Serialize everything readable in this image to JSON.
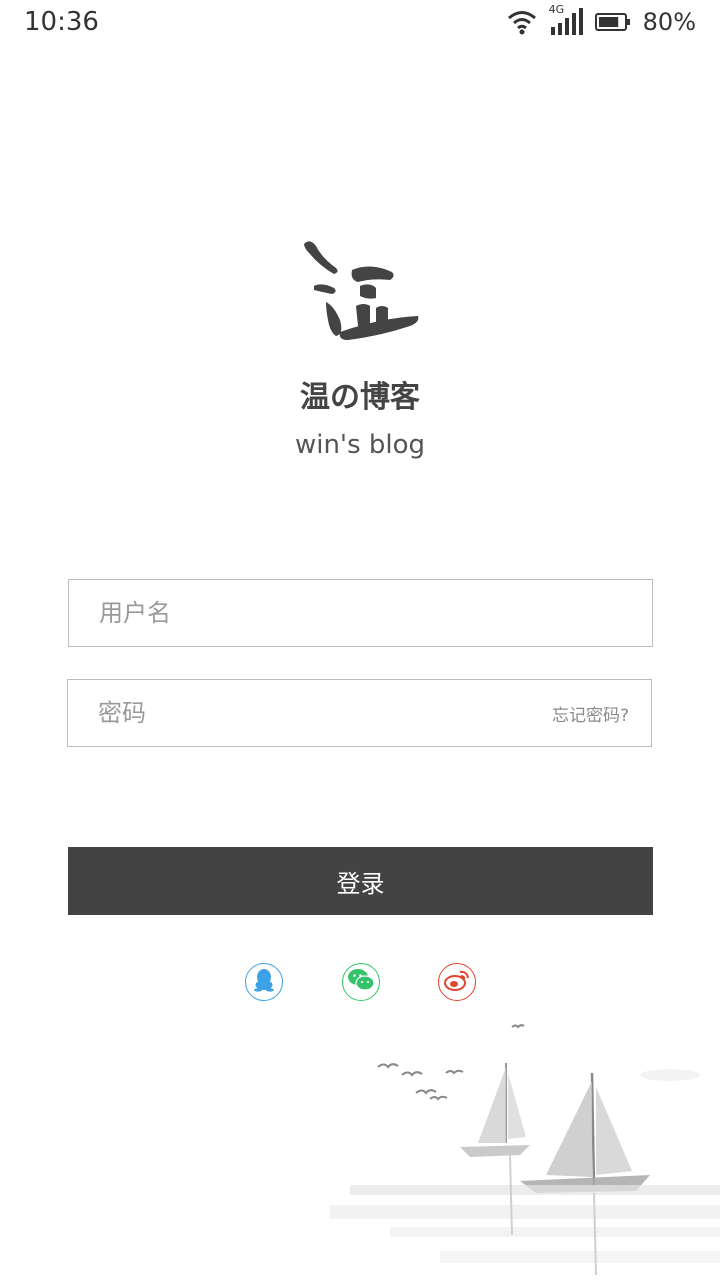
{
  "status_bar": {
    "time": "10:36",
    "network_label": "4G",
    "battery_percent": "80%",
    "battery_level": 0.8,
    "icons": [
      "wifi-icon",
      "cellular-signal-icon",
      "battery-icon"
    ]
  },
  "brand": {
    "logo_icon": "wen-calligraphy-logo",
    "title": "温の博客",
    "subtitle": "win's blog"
  },
  "login_form": {
    "username_placeholder": "用户名",
    "username_value": "",
    "password_placeholder": "密码",
    "password_value": "",
    "forgot_password_label": "忘记密码?",
    "login_button_label": "登录"
  },
  "social_login": [
    {
      "name": "qq",
      "icon": "qq-penguin-icon",
      "color": "#3da1e6"
    },
    {
      "name": "wechat",
      "icon": "wechat-icon",
      "color": "#34c36a"
    },
    {
      "name": "weibo",
      "icon": "weibo-icon",
      "color": "#e2452f"
    }
  ],
  "colors": {
    "primary_button": "#434343",
    "input_border": "#bdbdbd",
    "text": "#444444"
  }
}
